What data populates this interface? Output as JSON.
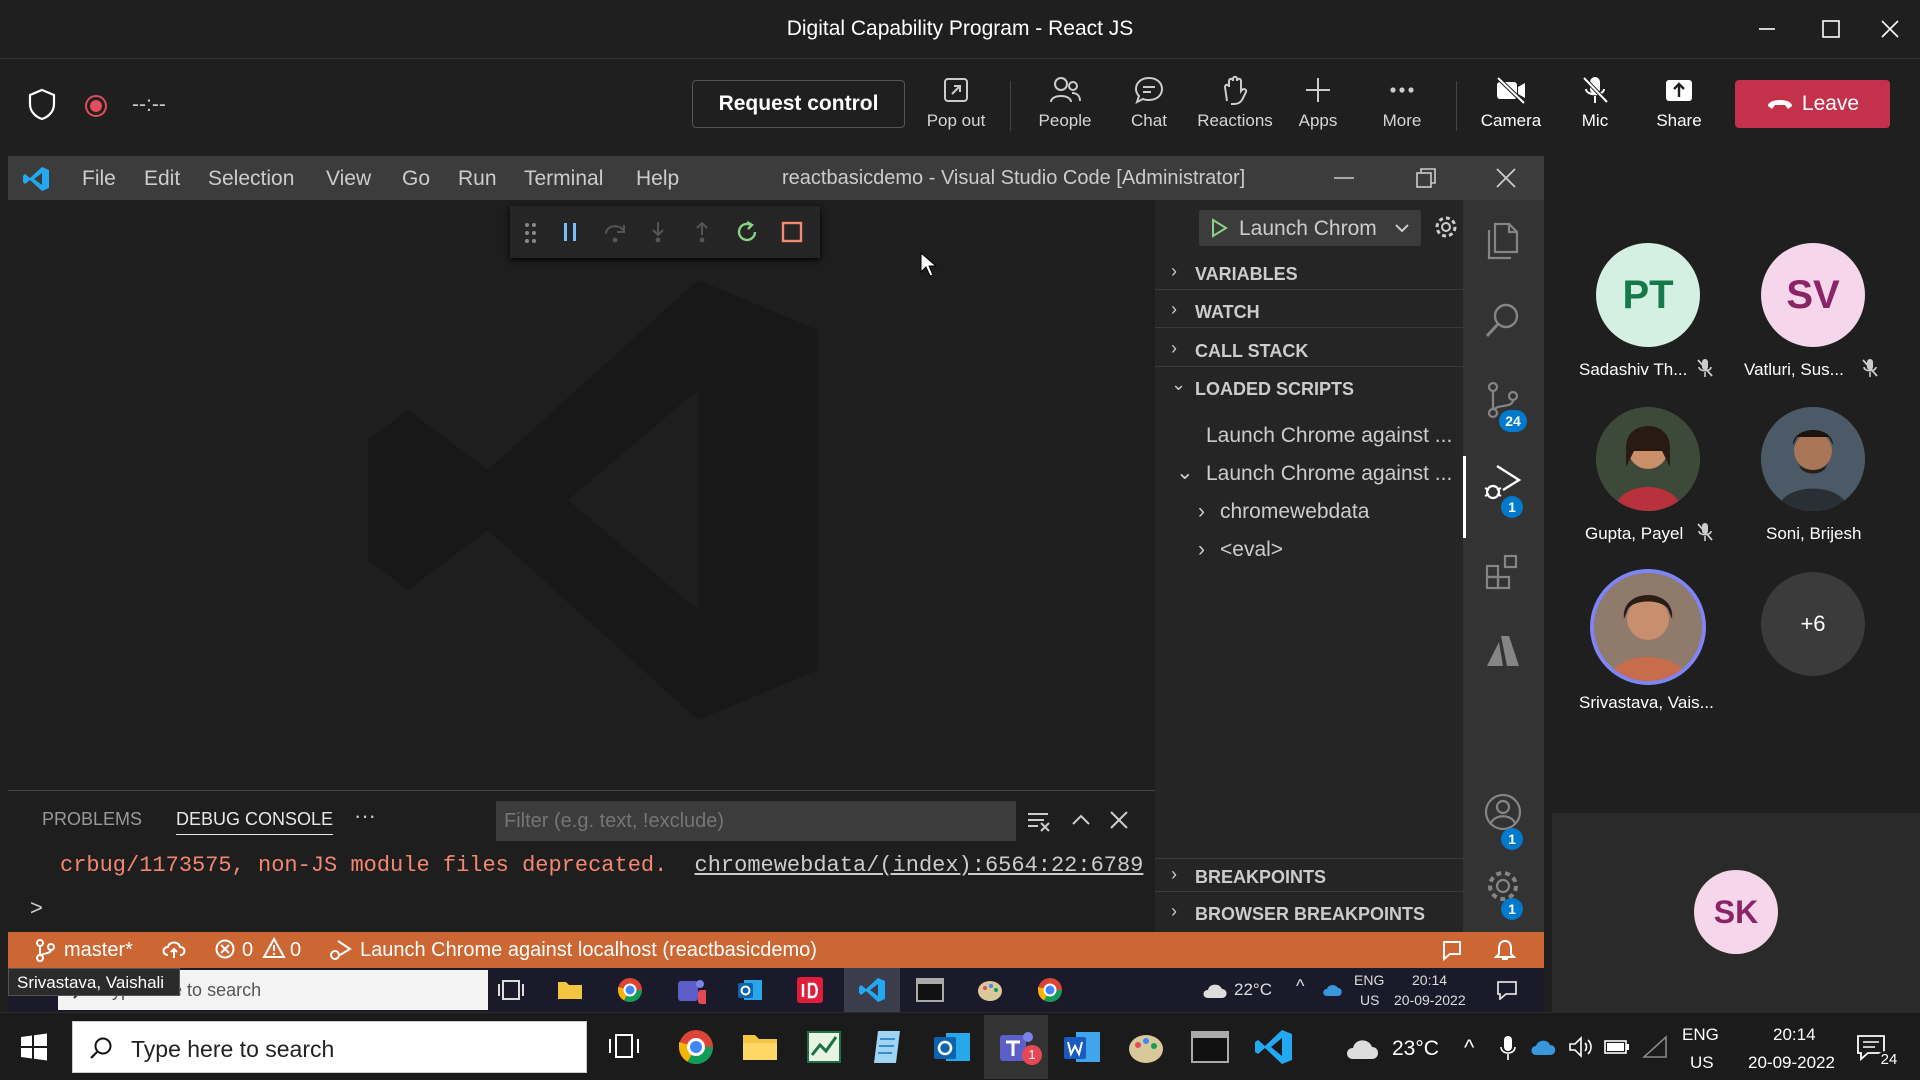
{
  "window": {
    "title": "Digital Capability Program - React JS"
  },
  "meeting": {
    "timer": "--:--",
    "request_control": "Request control",
    "toolbar": [
      {
        "label": "Pop out",
        "icon": "popout-icon"
      },
      {
        "label": "People",
        "icon": "people-icon"
      },
      {
        "label": "Chat",
        "icon": "chat-icon"
      },
      {
        "label": "Reactions",
        "icon": "reactions-icon"
      },
      {
        "label": "Apps",
        "icon": "plus-icon"
      },
      {
        "label": "More",
        "icon": "more-icon"
      },
      {
        "label": "Camera",
        "icon": "camera-off-icon"
      },
      {
        "label": "Mic",
        "icon": "mic-off-icon"
      },
      {
        "label": "Share",
        "icon": "share-icon"
      }
    ],
    "leave": "Leave",
    "participants": [
      {
        "initials": "PT",
        "name": "Sadashiv Th...",
        "bg": "#d3f0e2",
        "fg": "#16794a"
      },
      {
        "initials": "SV",
        "name": "Vatluri, Sus...",
        "bg": "#f6d6ea",
        "fg": "#8a2466"
      },
      {
        "initials": "",
        "name": "Gupta, Payel"
      },
      {
        "initials": "",
        "name": "Soni, Brijesh"
      },
      {
        "initials": "",
        "name": "Srivastava, Vais..."
      }
    ],
    "more_count": "+6",
    "self_initials": "SK"
  },
  "vscode": {
    "menu": [
      "File",
      "Edit",
      "Selection",
      "View",
      "Go",
      "Run",
      "Terminal",
      "Help"
    ],
    "title": "reactbasicdemo - Visual Studio Code [Administrator]",
    "launch_config": "Launch Chrom",
    "sections": {
      "variables": "VARIABLES",
      "watch": "WATCH",
      "call_stack": "CALL STACK",
      "loaded_scripts": "LOADED SCRIPTS",
      "breakpoints": "BREAKPOINTS",
      "browser_breakpoints": "BROWSER BREAKPOINTS"
    },
    "loaded_scripts": [
      "Launch Chrome against ...",
      "Launch Chrome against ...",
      "chromewebdata",
      "<eval>"
    ],
    "badges": {
      "scm": "24",
      "debug": "1",
      "account": "1",
      "settings": "1"
    },
    "panel": {
      "tabs": [
        "PROBLEMS",
        "DEBUG CONSOLE"
      ],
      "filter_placeholder": "Filter (e.g. text, !exclude)",
      "message": "crbug/1173575, non-JS module files deprecated.",
      "link": "chromewebdata/(index):6564:22:6789",
      "prompt": ">"
    },
    "status": {
      "branch": "master*",
      "errors": "0",
      "warnings": "0",
      "debug_target": "Launch Chrome against localhost (reactbasicdemo)"
    }
  },
  "tooltip": "Srivastava, Vaishali",
  "inner_taskbar": {
    "search": "Type here to search",
    "weather": "22°C",
    "lang1": "ENG",
    "lang2": "US",
    "time": "20:14",
    "date": "20-09-2022"
  },
  "taskbar": {
    "search": "Type here to search",
    "weather": "23°C",
    "lang1": "ENG",
    "lang2": "US",
    "time": "20:14",
    "date": "20-09-2022",
    "notifications": "24"
  },
  "colors": {
    "leave": "#c4314b",
    "statusbar": "#cc6633",
    "accent": "#6264a7"
  }
}
